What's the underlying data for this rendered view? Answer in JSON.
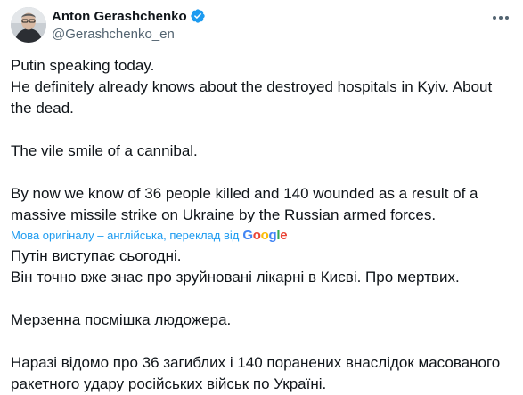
{
  "author": {
    "display_name": "Anton Gerashchenko",
    "handle": "@Gerashchenko_en",
    "verified_badge_icon": "verified-badge-icon",
    "more_icon": "more-options-icon"
  },
  "tweet": {
    "lines_1": [
      "Putin speaking today.",
      "He definitely already knows about the destroyed hospitals in Kyiv. About the dead."
    ],
    "line_2": "The vile smile of a cannibal.",
    "line_3": "By now we know of 36 people killed and 140 wounded as a result of a massive missile strike on Ukraine by the Russian armed forces."
  },
  "translation": {
    "link_text": "Мова оригіналу – англійська, переклад від",
    "provider": [
      "G",
      "o",
      "o",
      "g",
      "l",
      "e"
    ],
    "provider_colors": [
      "#4285f4",
      "#ea4335",
      "#fbbc05",
      "#4285f4",
      "#34a853",
      "#ea4335"
    ],
    "lines_1": [
      "Путін виступає сьогодні.",
      "Він точно вже знає про зруйновані лікарні в Києві. Про мертвих."
    ],
    "line_2": "Мерзенна посмішка людожера.",
    "line_3": "Наразі відомо про 36 загиблих і 140 поранених внаслідок масованого ракетного удару російських військ по Україні."
  },
  "colors": {
    "accent": "#1d9bf0",
    "text": "#0f1419",
    "secondary": "#536471"
  }
}
